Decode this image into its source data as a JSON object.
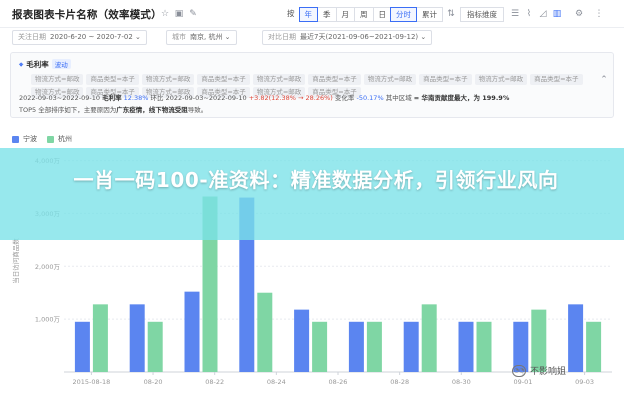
{
  "header": {
    "title": "报表图表卡片名称（效率模式）",
    "granularity": [
      "按",
      "年",
      "季",
      "月",
      "周",
      "日"
    ],
    "granularity_active": 1,
    "period_buttons": [
      "分时",
      "累计"
    ],
    "period_active": 0,
    "metric_button": "指标维度",
    "icons": [
      "favorite-icon",
      "image-icon",
      "edit-icon",
      "filter-icon",
      "table-icon",
      "line-chart-icon",
      "bar-chart-icon",
      "settings-icon",
      "more-icon"
    ]
  },
  "filters": [
    {
      "key": "关注日期",
      "value": "2020-6-20 ~ 2020-7-02 ⌄"
    },
    {
      "key": "城市",
      "value": "南京, 杭州 ⌄"
    },
    {
      "key": "对比日期",
      "value": "最近7天(2021-09-06~2021-09-12) ⌄"
    }
  ],
  "insight": {
    "metric": "毛利率",
    "tag": "波动",
    "chips": [
      "物流方式=邮政",
      "商品类型=本子",
      "物流方式=邮政",
      "商品类型=本子",
      "物流方式=邮政",
      "商品类型=本子",
      "物流方式=邮政",
      "商品类型=本子",
      "物流方式=邮政",
      "商品类型=本子",
      "物流方式=邮政",
      "商品类型=本子",
      "物流方式=邮政",
      "商品类型=本子",
      "物流方式=邮政",
      "商品类型=本子"
    ],
    "line1": {
      "range": "2022-09-03~2022-09-10",
      "metric": "毛利率",
      "value": "12.38%",
      "compare_label": "环比",
      "compare_range": "2022-09-03~2022-09-10",
      "delta": "+3.82(12.38% → 28.26%)",
      "change_label": "变化率",
      "change": "-50.17%",
      "region_text": "其中区域",
      "region": "= 华南贡献度最大，为 199.9%"
    },
    "line2": {
      "prefix": "TOP5 全部排序如下，主要原因为",
      "reason": "广东疫情，线下物流受阻",
      "suffix": "导致。"
    }
  },
  "legend": [
    {
      "name": "宁波",
      "color": "#5b85f0"
    },
    {
      "name": "杭州",
      "color": "#7fd6a4"
    }
  ],
  "banner": {
    "text": "一肖一码100-准资料：精准数据分析，引领行业风向"
  },
  "watermark": {
    "text": "不影响姐"
  },
  "chart_data": {
    "type": "bar",
    "ylabel": "当日访问商品数",
    "yticks": [
      "1,000万",
      "2,000万",
      "3,000万",
      "4,000万"
    ],
    "ylim": [
      0,
      4200
    ],
    "categories": [
      "2015-08-18",
      "08-20",
      "08-22",
      "08-24",
      "08-26",
      "08-28",
      "08-30",
      "09-01",
      "09-03"
    ],
    "series": [
      {
        "name": "宁波",
        "color": "#5b85f0",
        "values": [
          950,
          1280,
          1520,
          3300,
          1180,
          950,
          950,
          950,
          950,
          1280
        ]
      },
      {
        "name": "杭州",
        "color": "#7fd6a4",
        "values": [
          1280,
          950,
          3320,
          1500,
          950,
          950,
          1280,
          950,
          1180,
          950
        ]
      }
    ],
    "grid": true,
    "legend_position": "top-left"
  }
}
